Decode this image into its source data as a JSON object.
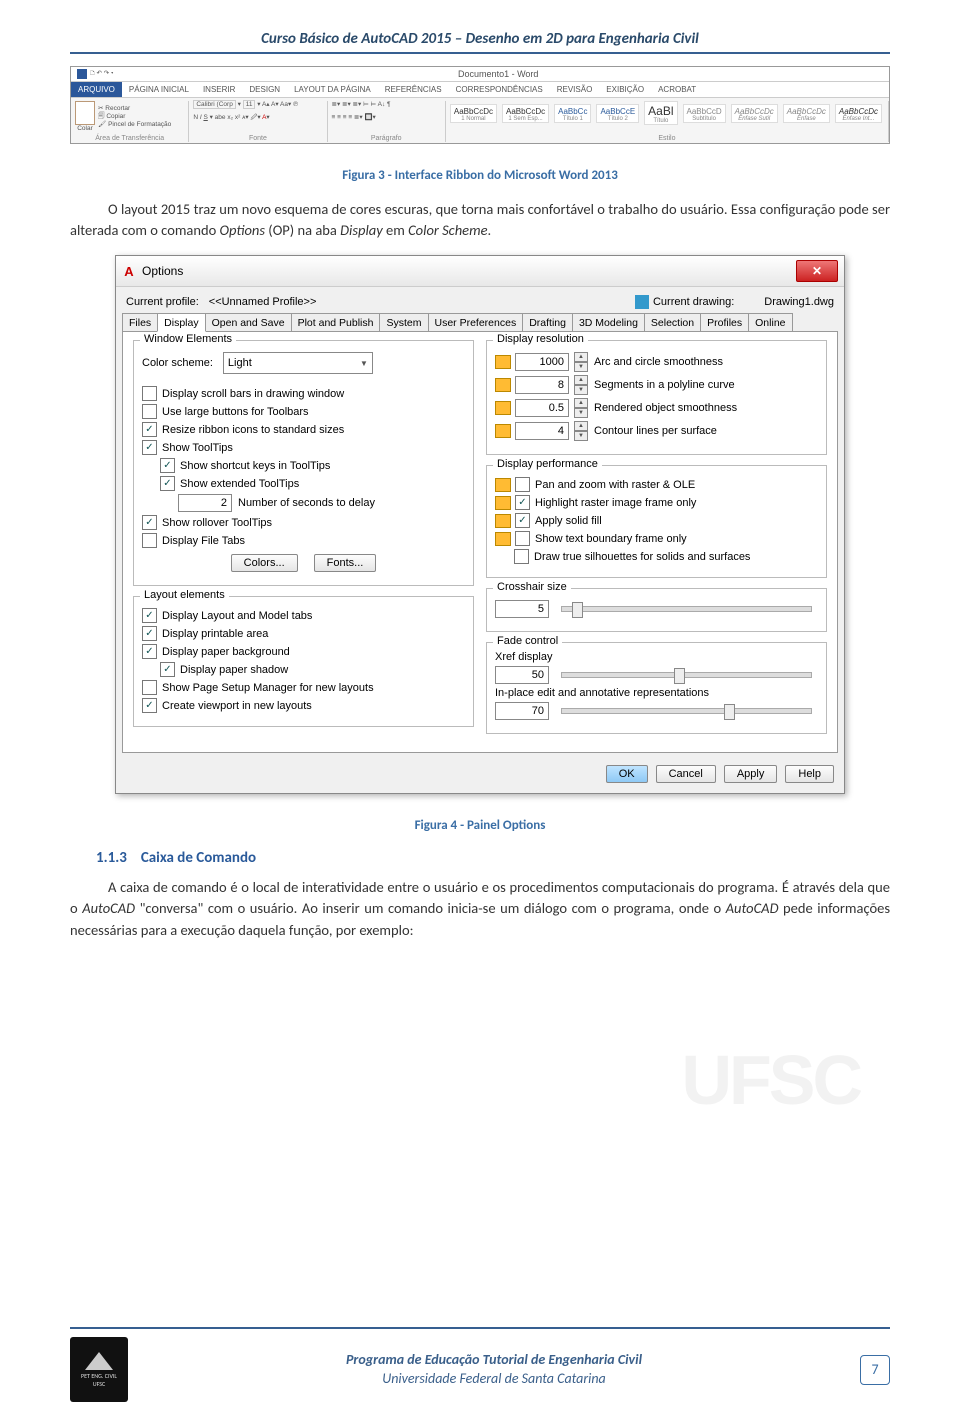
{
  "page_header": "Curso Básico de AutoCAD 2015 – Desenho em 2D para Engenharia Civil",
  "word": {
    "doc_title": "Documento1 - Word",
    "tabs": [
      "ARQUIVO",
      "PÁGINA INICIAL",
      "INSERIR",
      "DESIGN",
      "LAYOUT DA PÁGINA",
      "REFERÊNCIAS",
      "CORRESPONDÊNCIAS",
      "REVISÃO",
      "EXIBIÇÃO",
      "ACROBAT"
    ],
    "clipboard": [
      "Recortar",
      "Copiar",
      "Pincel de Formatação"
    ],
    "clipboard_label": "Área de Transferência",
    "paste": "Colar",
    "font_name": "Calibri (Corp",
    "font_size": "11",
    "font_label": "Fonte",
    "para_label": "Parágrafo",
    "styles": [
      {
        "sample": "AaBbCcDc",
        "name": "1 Normal"
      },
      {
        "sample": "AaBbCcDc",
        "name": "1 Sem Esp..."
      },
      {
        "sample": "AaBbCc",
        "name": "Título 1"
      },
      {
        "sample": "AaBbCcE",
        "name": "Título 2"
      },
      {
        "sample": "AaBl",
        "name": "Título"
      },
      {
        "sample": "AaBbCcD",
        "name": "Subtítulo"
      },
      {
        "sample": "AaBbCcDc",
        "name": "Ênfase Sutil"
      },
      {
        "sample": "AaBbCcDc",
        "name": "Ênfase"
      },
      {
        "sample": "AaBbCcDc",
        "name": "Ênfase Int..."
      }
    ],
    "styles_label": "Estilo"
  },
  "caption1": "Figura 3 - Interface Ribbon do Microsoft Word 2013",
  "para1_a": "O layout 2015 traz um novo esquema de cores escuras, que torna mais confortável o trabalho do usuário. Essa configuração pode ser alterada com o comando ",
  "para1_b": "Options",
  "para1_c": " (OP) na aba ",
  "para1_d": "Display",
  "para1_e": " em ",
  "para1_f": "Color Scheme",
  "para1_g": ".",
  "options": {
    "title": "Options",
    "profile_label": "Current profile:",
    "profile_value": "<<Unnamed Profile>>",
    "drawing_label": "Current drawing:",
    "drawing_value": "Drawing1.dwg",
    "tabs": [
      "Files",
      "Display",
      "Open and Save",
      "Plot and Publish",
      "System",
      "User Preferences",
      "Drafting",
      "3D Modeling",
      "Selection",
      "Profiles",
      "Online"
    ],
    "left": {
      "window_elements": "Window Elements",
      "color_scheme_label": "Color scheme:",
      "color_scheme_value": "Light",
      "scrollbars": "Display scroll bars in drawing window",
      "large_buttons": "Use large buttons for Toolbars",
      "resize_icons": "Resize ribbon icons to standard sizes",
      "tooltips": "Show ToolTips",
      "shortcut_keys": "Show shortcut keys in ToolTips",
      "extended_tt": "Show extended ToolTips",
      "delay_value": "2",
      "delay_label": "Number of seconds to delay",
      "rollover": "Show rollover ToolTips",
      "file_tabs": "Display File Tabs",
      "colors_btn": "Colors...",
      "fonts_btn": "Fonts...",
      "layout_elements": "Layout elements",
      "layout_tabs": "Display Layout and Model tabs",
      "printable": "Display printable area",
      "paper_bg": "Display paper background",
      "paper_shadow": "Display paper shadow",
      "page_setup": "Show Page Setup Manager for new layouts",
      "create_viewport": "Create viewport in new layouts"
    },
    "right": {
      "display_resolution": "Display resolution",
      "arc_value": "1000",
      "arc_label": "Arc and circle smoothness",
      "seg_value": "8",
      "seg_label": "Segments in a polyline curve",
      "rend_value": "0.5",
      "rend_label": "Rendered object smoothness",
      "cont_value": "4",
      "cont_label": "Contour lines per surface",
      "display_performance": "Display performance",
      "pan_zoom": "Pan and zoom with raster & OLE",
      "highlight_raster": "Highlight raster image frame only",
      "solid_fill": "Apply solid fill",
      "text_boundary": "Show text boundary frame only",
      "true_sil": "Draw true silhouettes for solids and surfaces",
      "crosshair": "Crosshair size",
      "crosshair_value": "5",
      "fade": "Fade control",
      "xref": "Xref display",
      "xref_value": "50",
      "inplace": "In-place edit and annotative representations",
      "inplace_value": "70"
    },
    "ok": "OK",
    "cancel": "Cancel",
    "apply": "Apply",
    "help": "Help"
  },
  "caption2": "Figura 4 - Painel Options",
  "watermark": "UFSC",
  "section": {
    "num": "1.1.3",
    "title": "Caixa de Comando"
  },
  "para2_a": "A caixa de comando é o local de interatividade entre o usuário e os procedimentos computacionais do programa. É através dela que o ",
  "para2_b": "AutoCAD",
  "para2_c": " \"conversa\" com o usuário. Ao inserir um comando inicia-se um diálogo com o programa, onde o ",
  "para2_d": "AutoCAD",
  "para2_e": " pede informações necessárias para a execução daquela função, por exemplo:",
  "footer": {
    "line1": "Programa de Educação Tutorial de Engenharia Civil",
    "line2": "Universidade Federal de Santa Catarina",
    "page": "7",
    "logo_text": "PET ENG. CIVIL\nUFSC"
  }
}
